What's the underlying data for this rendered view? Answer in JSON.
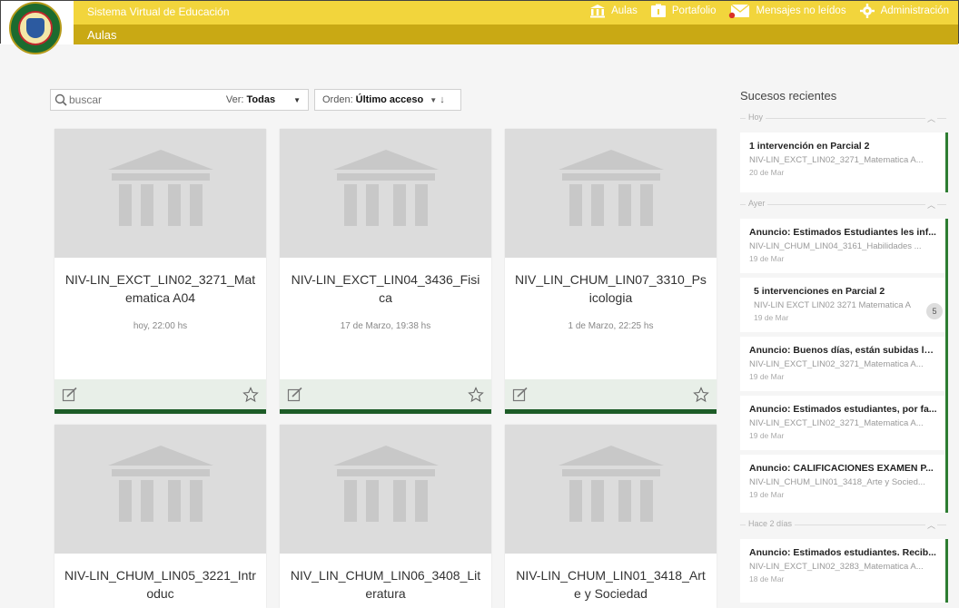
{
  "header": {
    "site_title": "Sistema Virtual de Educación",
    "section_title": "Aulas",
    "nav": [
      {
        "label": "Aulas",
        "icon": "building-icon"
      },
      {
        "label": "Portafolio",
        "icon": "folder-icon"
      },
      {
        "label": "Mensajes no leídos",
        "icon": "mail-icon"
      },
      {
        "label": "Administración",
        "icon": "gear-icon"
      }
    ]
  },
  "toolbar": {
    "search_placeholder": "buscar",
    "ver_label": "Ver:",
    "ver_value": "Todas",
    "orden_label": "Orden:",
    "orden_value": "Último acceso",
    "sort_arrow": "↓"
  },
  "courses": [
    {
      "title": "NIV-LIN_EXCT_LIN02_3271_Matematica A04",
      "date": "hoy, 22:00 hs"
    },
    {
      "title": "NIV-LIN_EXCT_LIN04_3436_Fisica",
      "date": "17 de Marzo, 19:38 hs"
    },
    {
      "title": "NIV_LIN_CHUM_LIN07_3310_Psicologia",
      "date": "1 de Marzo, 22:25 hs"
    },
    {
      "title": "NIV-LIN_CHUM_LIN05_3221_Introduc",
      "date": ""
    },
    {
      "title": "NIV_LIN_CHUM_LIN06_3408_Literatura",
      "date": ""
    },
    {
      "title": "NIV-LIN_CHUM_LIN01_3418_Arte y Sociedad",
      "date": ""
    }
  ],
  "sidebar": {
    "heading": "Sucesos recientes",
    "groups": [
      {
        "label": "Hoy",
        "events": [
          {
            "title": "1 intervención en Parcial 2",
            "course": "NIV-LIN_EXCT_LIN02_3271_Matematica A...",
            "date": "20 de Mar"
          }
        ]
      },
      {
        "label": "Ayer",
        "events": [
          {
            "title": "Anuncio: Estimados Estudiantes les inf...",
            "course": "NIV-LIN_CHUM_LIN04_3161_Habilidades ...",
            "date": "19 de Mar"
          },
          {
            "title": "5 intervenciones en Parcial 2",
            "course": "NIV-LIN EXCT LIN02 3271 Matematica A",
            "date": "19 de Mar",
            "badge": "5"
          },
          {
            "title": "Anuncio: Buenos días, están subidas la...",
            "course": "NIV-LIN_EXCT_LIN02_3271_Matematica A...",
            "date": "19 de Mar"
          },
          {
            "title": "Anuncio: Estimados estudiantes, por fa...",
            "course": "NIV-LIN_EXCT_LIN02_3271_Matematica A...",
            "date": "19 de Mar"
          },
          {
            "title": "Anuncio: CALIFICACIONES EXAMEN P...",
            "course": "NIV-LIN_CHUM_LIN01_3418_Arte y Socied...",
            "date": "19 de Mar"
          }
        ]
      },
      {
        "label": "Hace 2 días",
        "events": [
          {
            "title": "Anuncio: Estimados estudiantes. Recib...",
            "course": "NIV-LIN_EXCT_LIN02_3283_Matematica A...",
            "date": "18 de Mar"
          }
        ]
      }
    ]
  },
  "colors": {
    "header_yellow": "#f2d53c",
    "header_dark_yellow": "#c9a914",
    "accent_green": "#1d5c27"
  }
}
